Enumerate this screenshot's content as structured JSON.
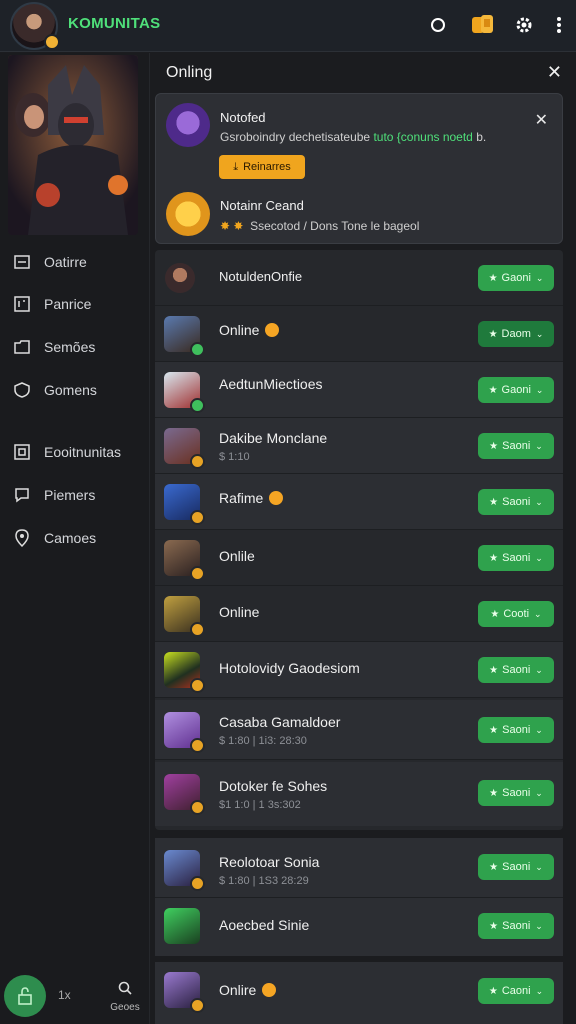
{
  "header": {
    "brand": "KOMUNITAS",
    "icons": [
      "notification-icon",
      "coins-icon",
      "settings-icon",
      "more-icon"
    ]
  },
  "sidebar": {
    "items": [
      {
        "label": "Oatirre",
        "icon": "list-icon"
      },
      {
        "label": "Panrice",
        "icon": "grid-icon"
      },
      {
        "label": "Semões",
        "icon": "folder-icon"
      },
      {
        "label": "Gomens",
        "icon": "shield-icon"
      },
      {
        "label": "Eooitnunitas",
        "icon": "community-icon"
      },
      {
        "label": "Piemers",
        "icon": "chat-icon"
      },
      {
        "label": "Camoes",
        "icon": "pin-icon"
      }
    ],
    "bottom": {
      "count": "1x",
      "search_label": "Geoes"
    }
  },
  "main": {
    "title": "Onling",
    "notification": {
      "item1": {
        "title": "Notofed",
        "text": "Gsroboindry dechetisateube",
        "highlight": "tuto {conuns noetd",
        "suffix": "b.",
        "button": "Reinarres"
      },
      "item2": {
        "title": "Notainr Ceand",
        "text": "Ssecotod / Dons Tone le bageol"
      }
    },
    "rows": [
      {
        "name": "NotuldenOnfie",
        "sub": "",
        "emoji": false,
        "button": "Gaoni"
      },
      {
        "name": "Online",
        "sub": "",
        "emoji": true,
        "button": "Daom"
      },
      {
        "name": "AedtunMiectioes",
        "sub": "",
        "emoji": false,
        "button": "Gaoni"
      },
      {
        "name": "Dakibe Monclane",
        "sub": "$ 1:10",
        "emoji": false,
        "button": "Saoni"
      },
      {
        "name": "Rafime",
        "sub": "",
        "emoji": true,
        "button": "Saoni"
      },
      {
        "name": "Onlile",
        "sub": "",
        "emoji": false,
        "button": "Saoni"
      },
      {
        "name": "Online",
        "sub": "",
        "emoji": false,
        "button": "Cooti"
      },
      {
        "name": "Hotolovidy Gaodesiom",
        "sub": "",
        "emoji": false,
        "button": "Saoni"
      },
      {
        "name": "Casaba Gamaldoer",
        "sub": "$ 1:80  |  1i3: 28:30",
        "emoji": false,
        "button": "Saoni"
      },
      {
        "name": "Dotoker fe Sohes",
        "sub": "$1 1:0  |  1 3s:302",
        "emoji": false,
        "button": "Saoni"
      },
      {
        "name": "Reolotoar Sonia",
        "sub": "$ 1:80  |  1S3 28:29",
        "emoji": false,
        "button": "Saoni"
      },
      {
        "name": "Aoecbed Sinie",
        "sub": "",
        "emoji": false,
        "button": "Saoni"
      },
      {
        "name": "Onlire",
        "sub": "",
        "emoji": true,
        "button": "Caoni"
      }
    ]
  },
  "colors": {
    "accent_green": "#2fa24d",
    "brand_green": "#4fe07a",
    "notify_orange": "#f0a51e",
    "background": "#1b1c1f"
  }
}
